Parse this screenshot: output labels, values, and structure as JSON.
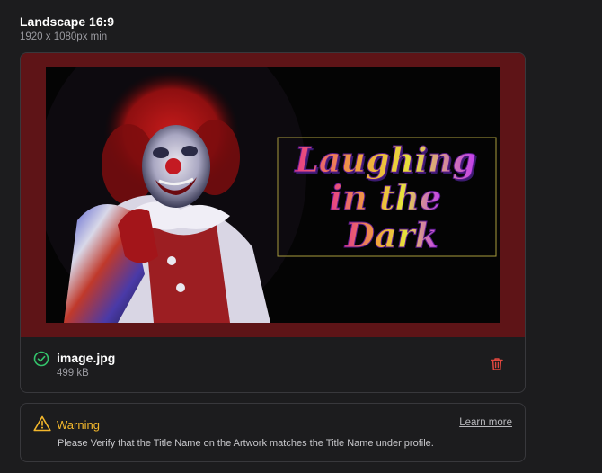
{
  "header": {
    "title": "Landscape 16:9",
    "subtitle": "1920 x 1080px min"
  },
  "artwork": {
    "title_text_line1": "Laughing",
    "title_text_line2": "in the",
    "title_text_line3": "Dark"
  },
  "file": {
    "name": "image.jpg",
    "size": "499 kB",
    "status_icon": "check-circle-icon",
    "delete_icon": "trash-icon"
  },
  "warning": {
    "title": "Warning",
    "link_label": "Learn more",
    "message": "Please Verify that the Title Name on the Artwork matches the Title Name under profile.",
    "icon": "warning-triangle-icon"
  },
  "colors": {
    "background": "#1c1c1e",
    "frame": "#5e1417",
    "success": "#33c36b",
    "danger": "#e0473f",
    "warning": "#f3b72c"
  }
}
